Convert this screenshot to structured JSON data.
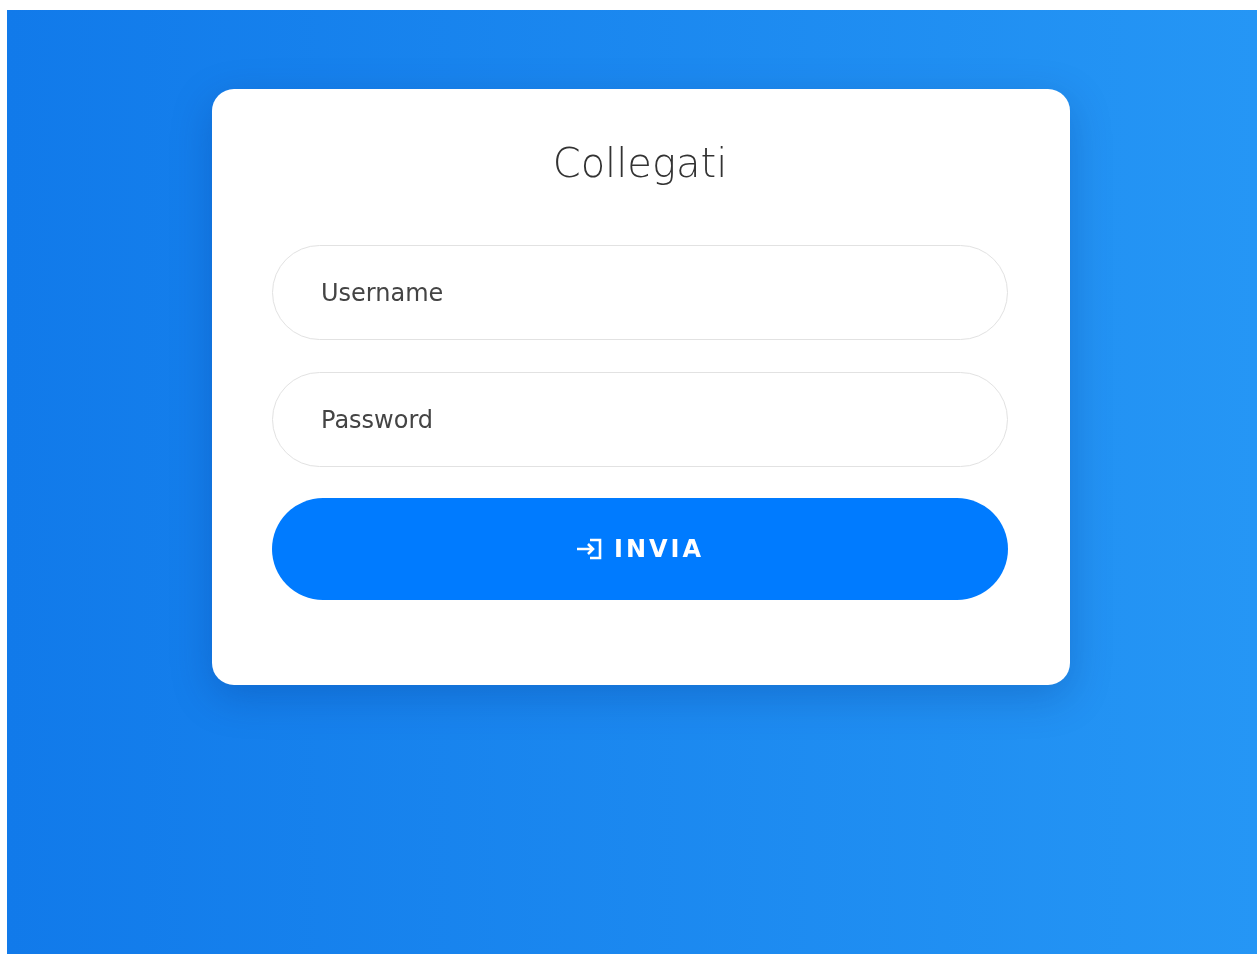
{
  "title": "Collegati",
  "fields": [
    {
      "placeholder": "Username"
    },
    {
      "placeholder": "Password"
    }
  ],
  "submit_button": {
    "label": "INVIA"
  }
}
